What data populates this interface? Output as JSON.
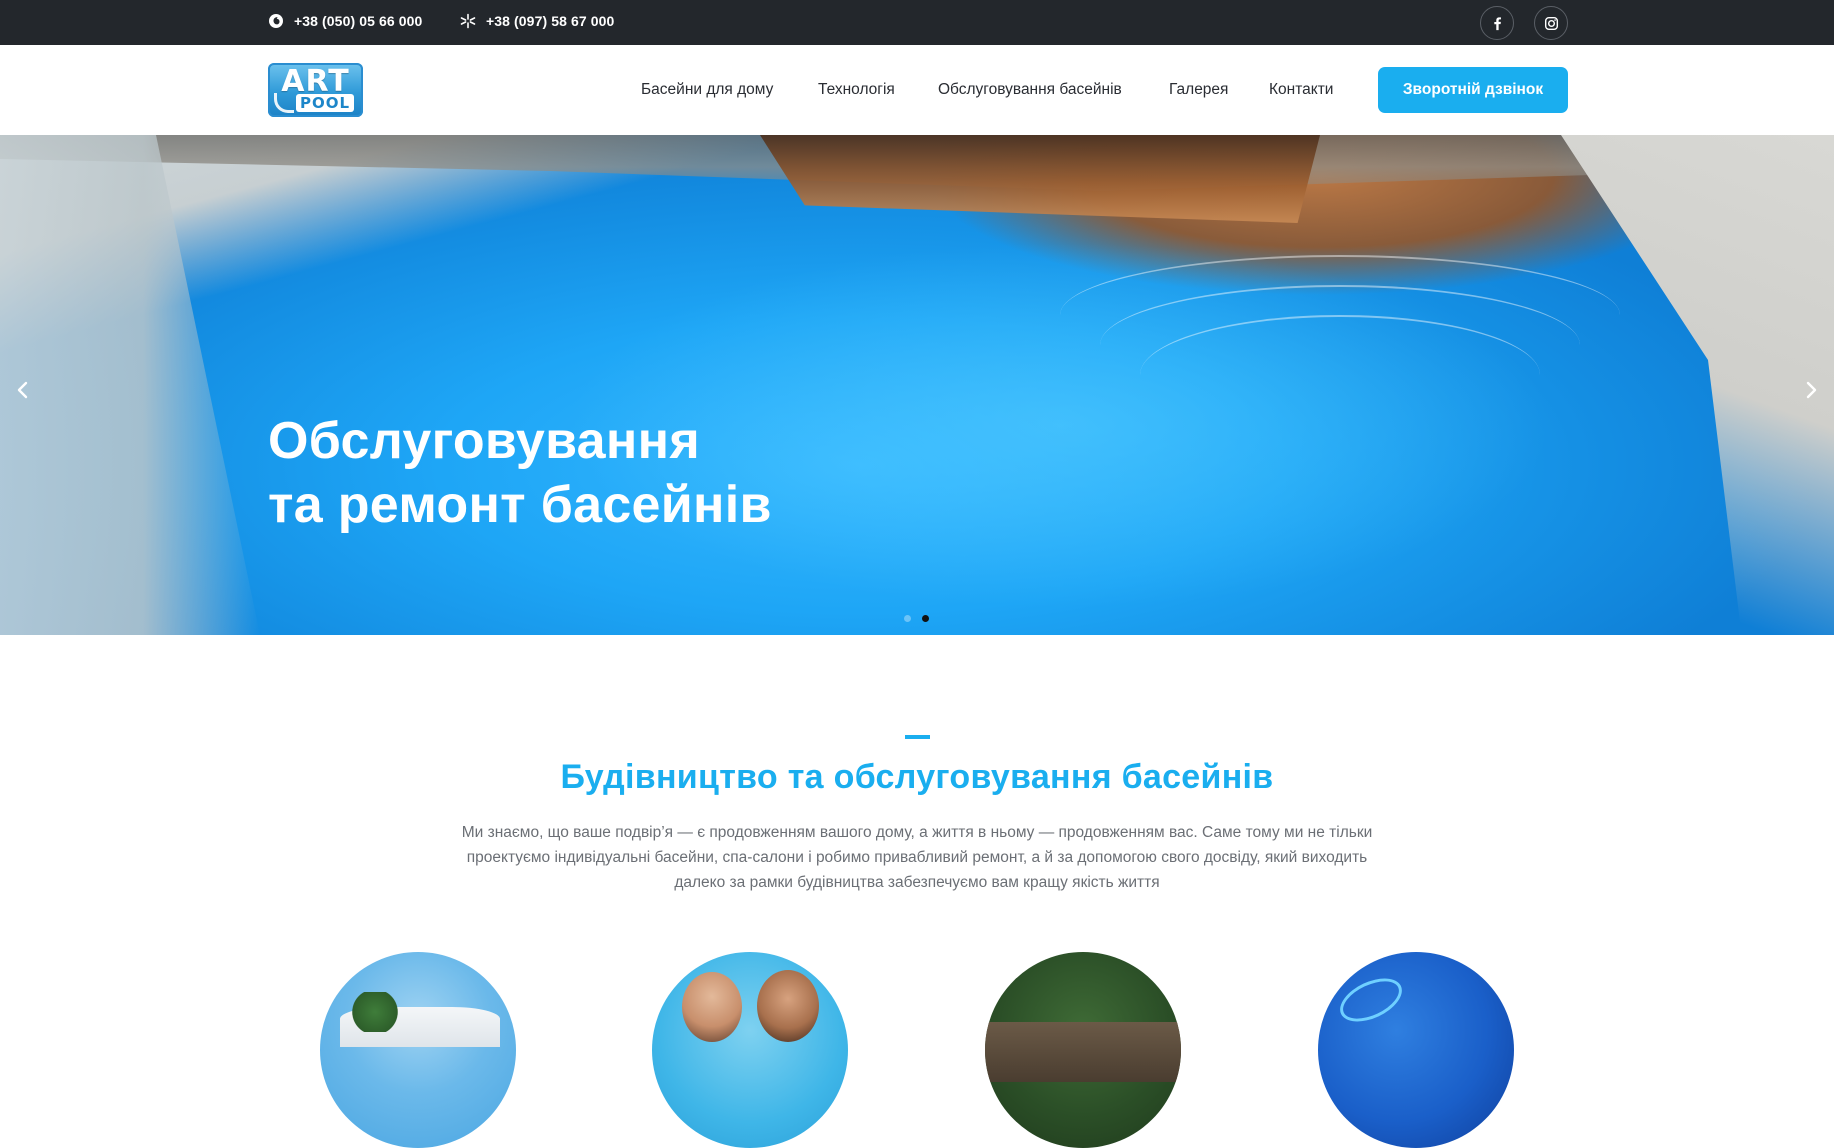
{
  "topbar": {
    "phone1": "+38 (050) 05 66 000",
    "phone1_icon": "vodafone-icon",
    "phone2": "+38 (097) 58 67 000",
    "phone2_icon": "kyivstar-icon",
    "social": [
      "facebook-icon",
      "instagram-icon"
    ]
  },
  "header": {
    "logo": {
      "line1": "ART",
      "line2": "POOL"
    },
    "nav": [
      {
        "label": "Басейни для дому"
      },
      {
        "label": "Технологія"
      },
      {
        "label": "Обслуговування басейнів"
      },
      {
        "label": "Галерея"
      },
      {
        "label": "Контакти"
      }
    ],
    "cta_label": "Зворотній дзвінок"
  },
  "hero": {
    "title_line1": "Обслуговування",
    "title_line2": "та ремонт басейнів",
    "slides_total": 2,
    "active_slide": 2
  },
  "intro": {
    "title": "Будівництво та обслуговування басейнів",
    "text": "Ми знаємо, що ваше подвір’я — є продовженням вашого дому, а життя в ньому — продовженням вас. Саме тому ми не тільки проектуємо індивідуальні басейни, спа-салони і робимо привабливий ремонт, а й за допомогою свого досвіду, який виходить далеко за рамки будівництва забезпечуємо вам кращу якість життя"
  },
  "colors": {
    "accent": "#1aaeef",
    "topbar": "#23272c",
    "text": "#2a2d33",
    "muted": "#6b6f75"
  }
}
